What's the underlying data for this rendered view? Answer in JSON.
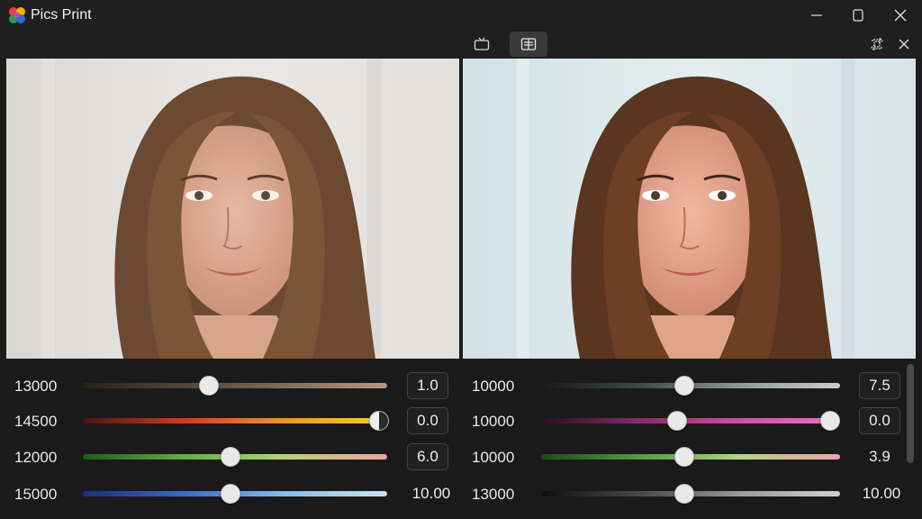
{
  "app": {
    "title": "Pics Print"
  },
  "toolbar": {
    "buttons": [
      {
        "icon": "tv-view-icon",
        "active": false
      },
      {
        "icon": "compare-view-icon",
        "active": true
      }
    ],
    "right_buttons": [
      {
        "icon": "crop-rotate-icon"
      },
      {
        "icon": "close-icon"
      }
    ]
  },
  "window_controls": [
    "minimize-icon",
    "restore-icon",
    "close-icon"
  ],
  "left_panel": {
    "sliders": [
      {
        "label": "13000",
        "value": "1.0",
        "level": 0.43,
        "track": "brown-gradient"
      },
      {
        "label": "14500",
        "value": "0.0",
        "level": 0.98,
        "track": "red-orange-yellow-gradient"
      },
      {
        "label": "12000",
        "value": "6.0",
        "level": 0.49,
        "track": "green-pink-gradient"
      },
      {
        "label": "15000",
        "value": "10.00",
        "level": 0.49,
        "track": "blue-lightblue-gradient"
      }
    ]
  },
  "right_panel": {
    "sliders": [
      {
        "label": "10000",
        "value": "7.5",
        "level": 0.48,
        "track": "dark-gray-gradient"
      },
      {
        "label": "10000",
        "value": "0.0",
        "level": 0.45,
        "second_level": 0.97,
        "track": "magenta-pink-gradient"
      },
      {
        "label": "10000",
        "value": "3.9",
        "level": 0.48,
        "track": "green-pink-gradient"
      },
      {
        "label": "13000",
        "value": "10.00",
        "level": 0.48,
        "track": "black-gray-gradient"
      }
    ]
  },
  "colors": {
    "background": "#1c1c1c",
    "titlebar": "#1f1f1f",
    "thumb": "#e9e9e9"
  }
}
